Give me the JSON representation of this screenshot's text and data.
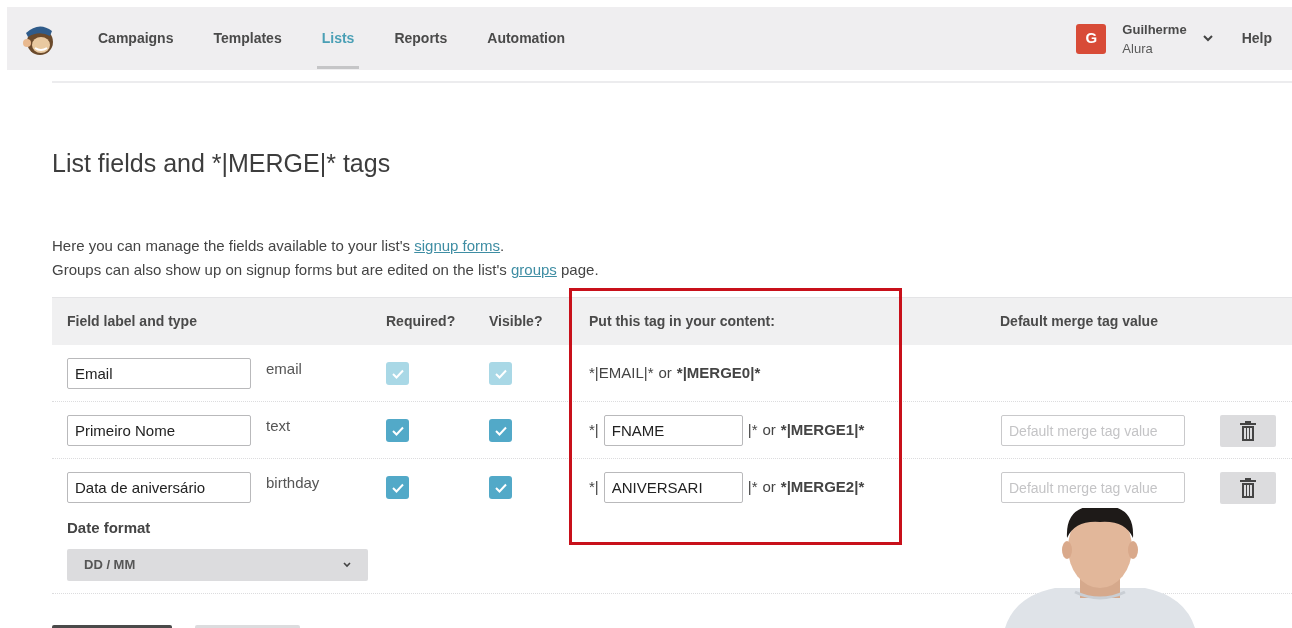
{
  "nav": {
    "items": [
      {
        "label": "Campaigns",
        "selected": false
      },
      {
        "label": "Templates",
        "selected": false
      },
      {
        "label": "Lists",
        "selected": true
      },
      {
        "label": "Reports",
        "selected": false
      },
      {
        "label": "Automation",
        "selected": false
      }
    ],
    "user": {
      "initial": "G",
      "name": "Guilherme",
      "account": "Alura"
    },
    "help": "Help"
  },
  "page": {
    "title": "List fields and *|MERGE|* tags",
    "intro": [
      {
        "before": "Here you can manage the fields available to your list's ",
        "link": "signup forms",
        "after": "."
      },
      {
        "before": "Groups can also show up on signup forms but are edited on the list's ",
        "link": "groups",
        "after": " page."
      }
    ]
  },
  "table": {
    "columns": [
      "Field label and type",
      "Required?",
      "Visible?",
      "Put this tag in your content:",
      "Default merge tag value"
    ],
    "rows": [
      {
        "label": "Email",
        "type": "email",
        "required": {
          "checked": true,
          "disabled": true
        },
        "visible": {
          "checked": true,
          "disabled": true
        },
        "tag": {
          "kind": "static",
          "text": "*|EMAIL|*",
          "connector": "or",
          "merge": "*|MERGE0|*"
        }
      },
      {
        "label": "Primeiro Nome",
        "type": "text",
        "required": {
          "checked": true,
          "disabled": false
        },
        "visible": {
          "checked": true,
          "disabled": false
        },
        "tag": {
          "kind": "editable",
          "prefix": "*|",
          "value": "FNAME",
          "suffix": "|*",
          "connector": "or",
          "merge": "*|MERGE1|*"
        },
        "default_placeholder": "Default merge tag value",
        "deletable": true
      },
      {
        "label": "Data de aniversário",
        "type": "birthday",
        "required": {
          "checked": true,
          "disabled": false
        },
        "visible": {
          "checked": true,
          "disabled": false
        },
        "tag": {
          "kind": "editable",
          "prefix": "*|",
          "value": "ANIVERSARI",
          "suffix": "|*",
          "connector": "or",
          "merge": "*|MERGE2|*"
        },
        "default_placeholder": "Default merge tag value",
        "deletable": true,
        "date_format": {
          "label": "Date format",
          "value": "DD / MM"
        }
      }
    ]
  }
}
